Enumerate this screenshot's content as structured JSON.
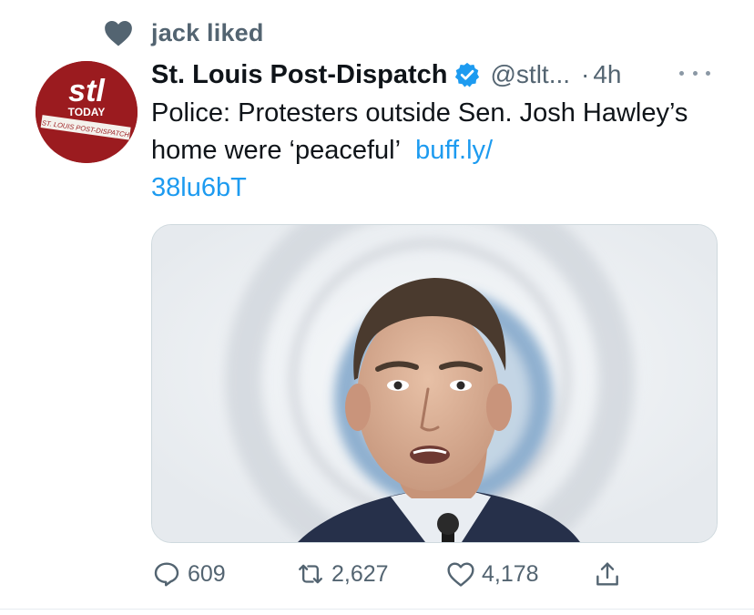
{
  "social_context": {
    "icon": "heart-icon",
    "text": "jack liked"
  },
  "author": {
    "name": "St. Louis Post-Dispatch",
    "verified": true,
    "handle": "@stlt...",
    "separator": "·",
    "time": "4h",
    "avatar": {
      "logo_text": "stl",
      "badge_text": "TODAY",
      "banner_text": "ST. LOUIS POST-DISPATCH",
      "brand_color": "#9b1b1f"
    }
  },
  "tweet": {
    "text": "Police: Protesters outside Sen. Josh Hawley’s home were ‘peaceful’",
    "link_part1": "buff.ly/",
    "link_part2": "38lu6bT"
  },
  "media": {
    "kind": "photo"
  },
  "actions": {
    "reply": {
      "icon": "reply-icon",
      "count": "609"
    },
    "retweet": {
      "icon": "retweet-icon",
      "count": "2,627"
    },
    "like": {
      "icon": "like-heart-icon",
      "count": "4,178"
    },
    "share": {
      "icon": "share-icon"
    }
  },
  "colors": {
    "link": "#1d9bf0",
    "secondary_text": "#536471",
    "verified_badge": "#1d9bf0"
  }
}
